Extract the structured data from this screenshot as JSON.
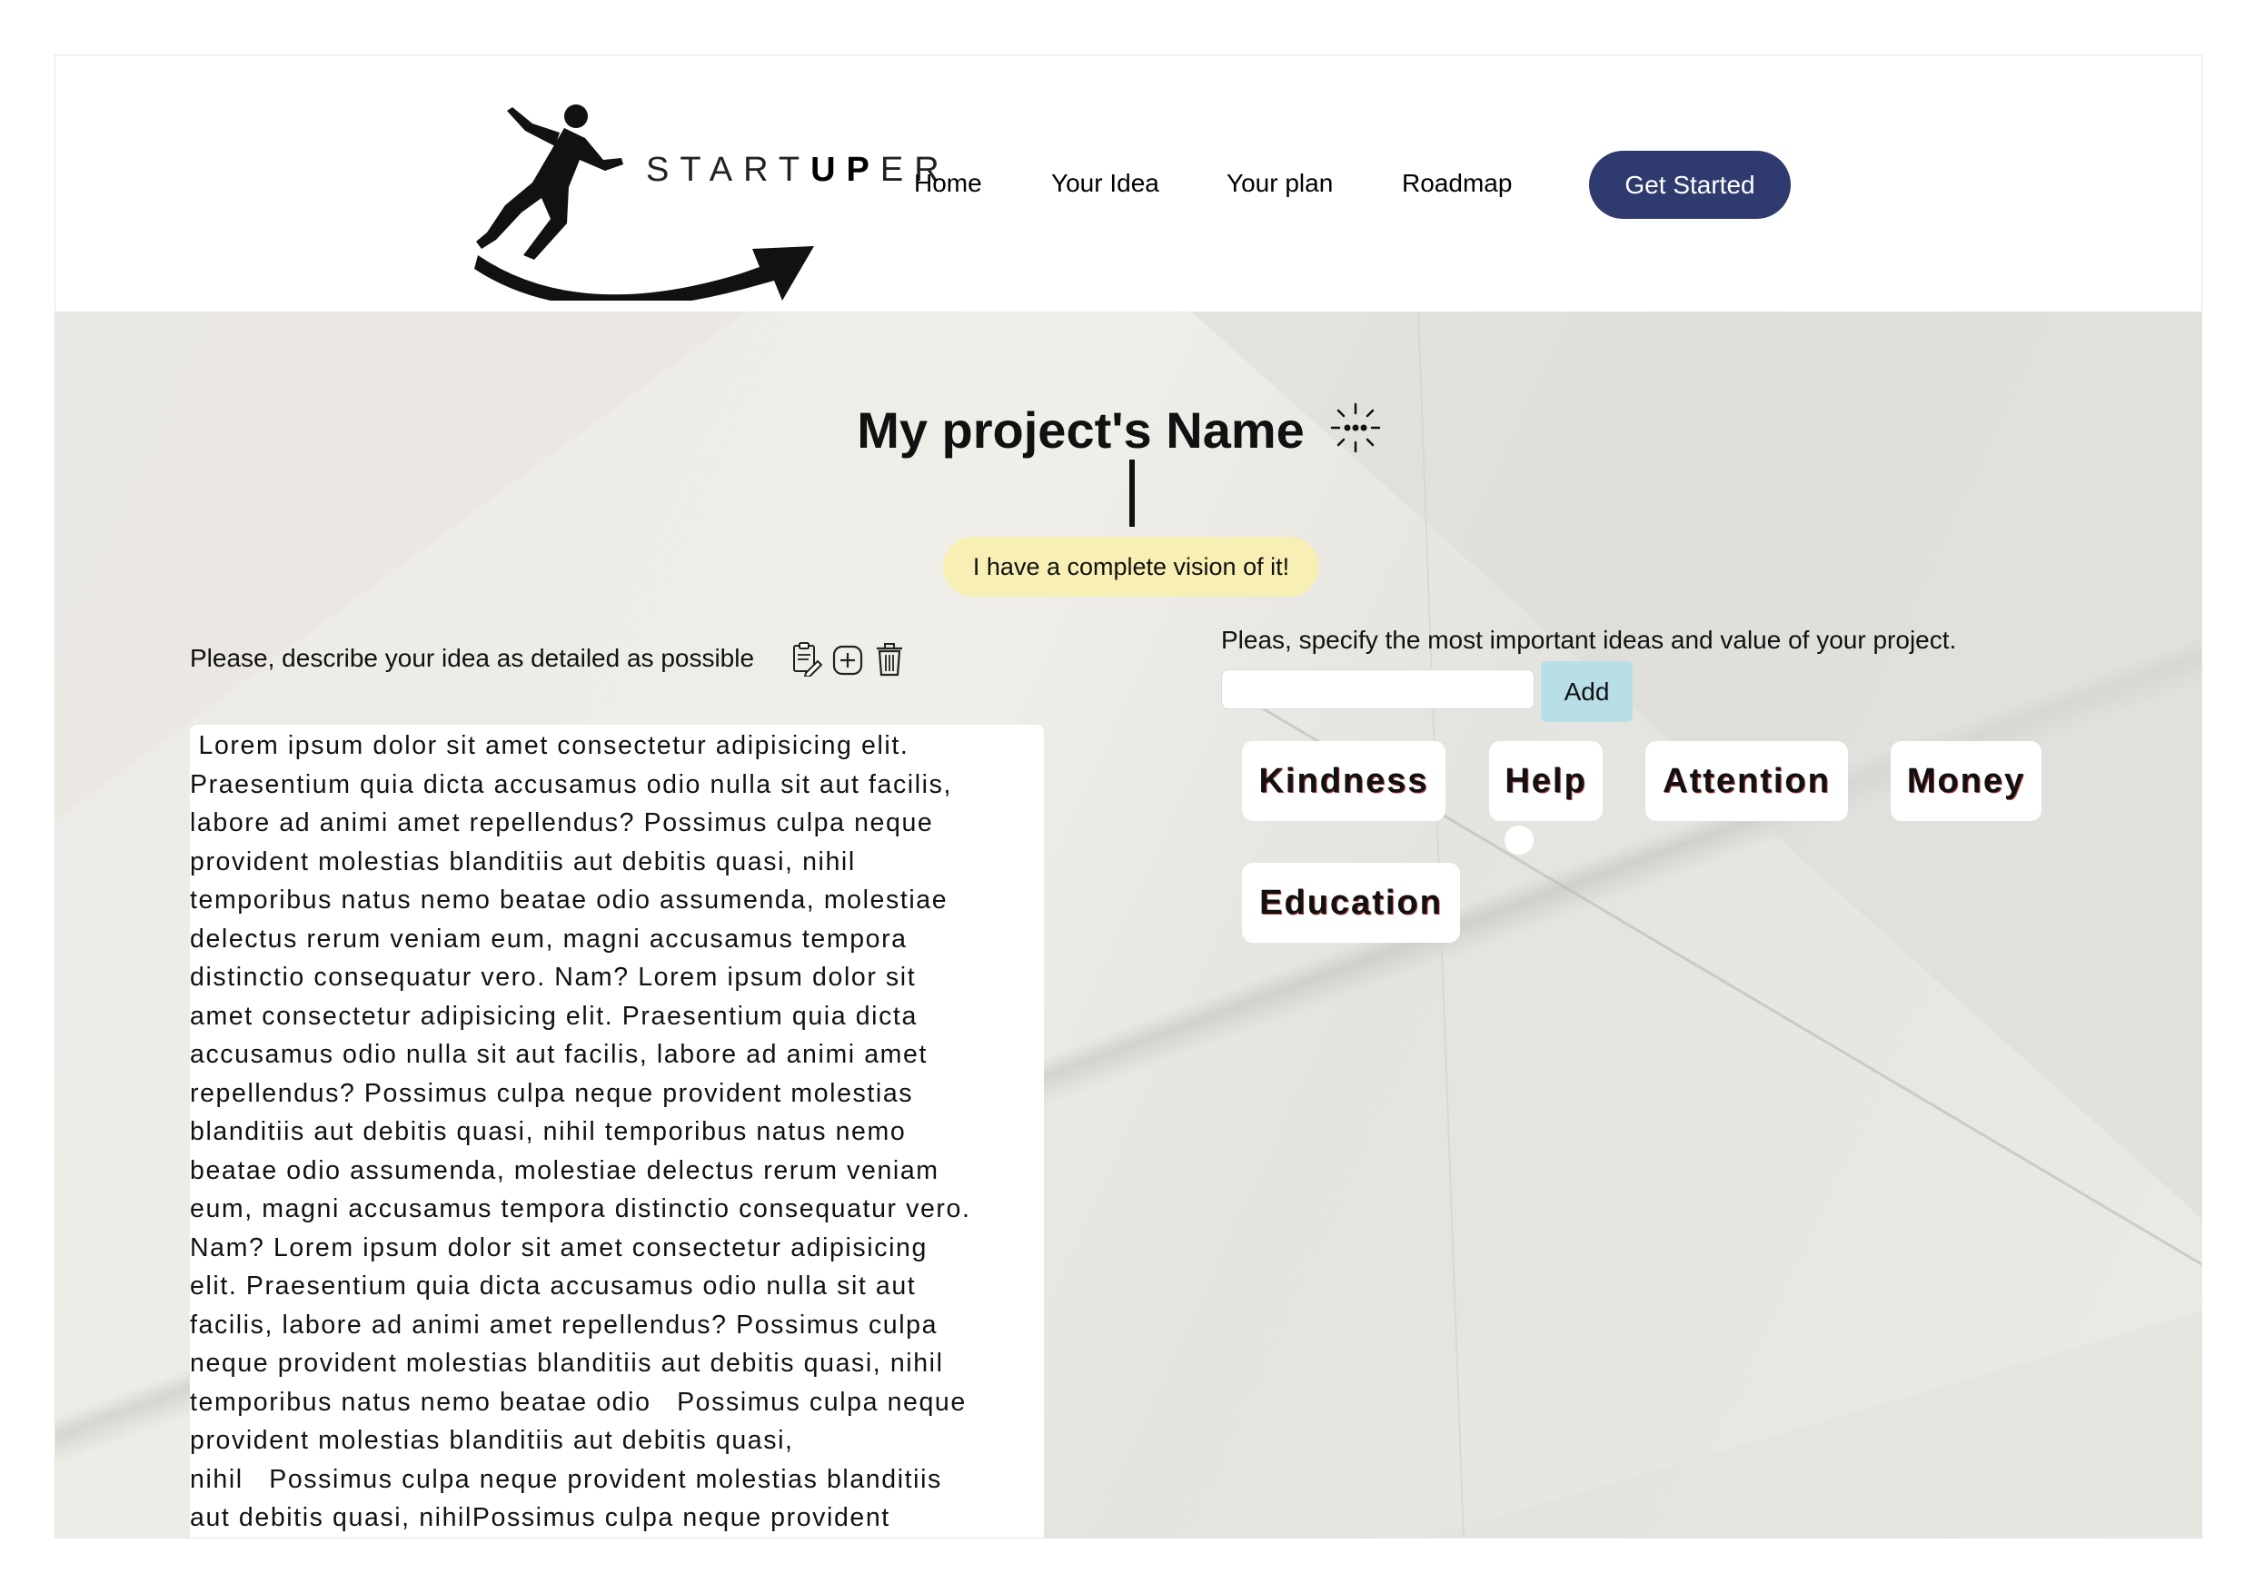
{
  "header": {
    "logo": {
      "text_prefix": "START",
      "text_bold": "UP",
      "text_suffix": "ER"
    },
    "nav": [
      {
        "label": "Home"
      },
      {
        "label": "Your Idea"
      },
      {
        "label": "Your plan"
      },
      {
        "label": "Roadmap"
      }
    ],
    "cta_label": "Get Started",
    "cta_color": "#2f3b6e"
  },
  "project": {
    "title": "My project's Name",
    "status": "I have a complete vision of it!",
    "status_color": "#f7efb3"
  },
  "description": {
    "label": "Please, describe your idea as detailed as possible",
    "icons": [
      "edit-document-icon",
      "add-icon",
      "trash-icon"
    ],
    "text": " Lorem ipsum dolor sit amet consectetur adipisicing elit.\nPraesentium quia dicta accusamus odio nulla sit aut facilis,\nlabore ad animi amet repellendus? Possimus culpa neque\nprovident molestias blanditiis aut debitis quasi, nihil\ntemporibus natus nemo beatae odio assumenda, molestiae\ndelectus rerum veniam eum, magni accusamus tempora\ndistinctio consequatur vero. Nam? Lorem ipsum dolor sit\namet consectetur adipisicing elit. Praesentium quia dicta\naccusamus odio nulla sit aut facilis, labore ad animi amet\nrepellendus? Possimus culpa neque provident molestias\nblanditiis aut debitis quasi, nihil temporibus natus nemo\nbeatae odio assumenda, molestiae delectus rerum veniam\neum, magni accusamus tempora distinctio consequatur vero.\nNam? Lorem ipsum dolor sit amet consectetur adipisicing\nelit. Praesentium quia dicta accusamus odio nulla sit aut\nfacilis, labore ad animi amet repellendus? Possimus culpa\nneque provident molestias blanditiis aut debitis quasi, nihil\ntemporibus natus nemo beatae odio   Possimus culpa neque\nprovident molestias blanditiis aut debitis quasi,\nnihil   Possimus culpa neque provident molestias blanditiis\naut debitis quasi, nihilPossimus culpa neque provident"
  },
  "values": {
    "label": "Pleas, specify the most important ideas and value of your project.",
    "input_value": "",
    "add_label": "Add",
    "add_color": "#b8dfe6",
    "tags": [
      {
        "label": "Kindness"
      },
      {
        "label": "Help"
      },
      {
        "label": "Attention"
      },
      {
        "label": "Money"
      },
      {
        "label": "Education"
      }
    ]
  }
}
